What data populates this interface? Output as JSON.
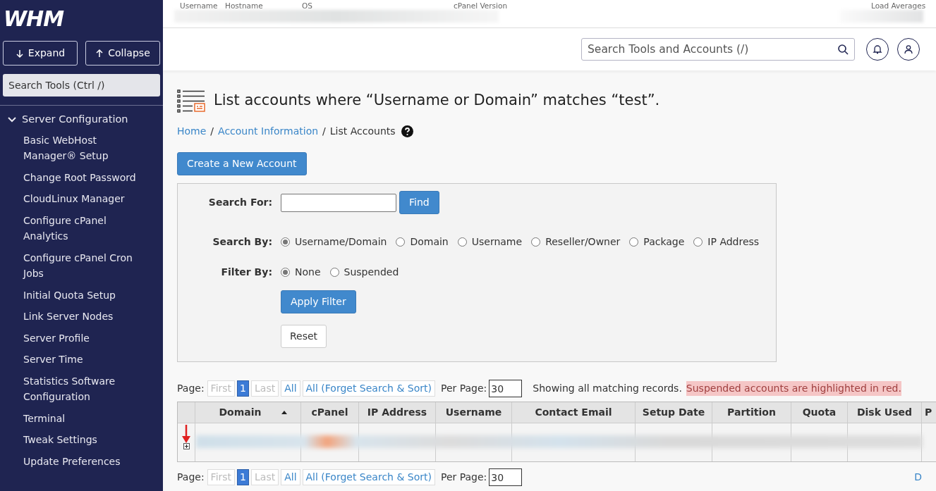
{
  "sidebar": {
    "logo": "WHM",
    "buttons": [
      {
        "kind": "expand",
        "label": "Expand"
      },
      {
        "kind": "collapse",
        "label": "Collapse"
      }
    ],
    "search": {
      "placeholder": "Search Tools (Ctrl /)"
    },
    "section": {
      "label": "Server Configuration",
      "expanded": true,
      "items": [
        "Basic WebHost Manager® Setup",
        "Change Root Password",
        "CloudLinux Manager",
        "Configure cPanel Analytics",
        "Configure cPanel Cron Jobs",
        "Initial Quota Setup",
        "Link Server Nodes",
        "Server Profile",
        "Server Time",
        "Statistics Software Configuration",
        "Terminal",
        "Tweak Settings",
        "Update Preferences"
      ]
    }
  },
  "server_info": {
    "labels": [
      "Username",
      "Hostname",
      "OS",
      "cPanel Version",
      "Load Averages"
    ]
  },
  "header": {
    "search": {
      "placeholder": "Search Tools and Accounts (/)"
    }
  },
  "page": {
    "title": "List accounts where “Username or Domain” matches “test”.",
    "breadcrumb": [
      {
        "label": "Home",
        "link": true,
        "separator": "/"
      },
      {
        "label": "Account Information",
        "link": true,
        "separator": "/"
      },
      {
        "label": "List Accounts",
        "link": false
      }
    ],
    "create_button": "Create a New Account",
    "form": {
      "search_label": "Search For:",
      "find_button": "Find",
      "search_by": {
        "label": "Search By:",
        "options": [
          {
            "label": "Username/Domain",
            "selected": true
          },
          {
            "label": "Domain",
            "selected": false
          },
          {
            "label": "Username",
            "selected": false
          },
          {
            "label": "Reseller/Owner",
            "selected": false
          },
          {
            "label": "Package",
            "selected": false
          },
          {
            "label": "IP Address",
            "selected": false
          }
        ]
      },
      "filter_by": {
        "label": "Filter By:",
        "options": [
          {
            "label": "None",
            "selected": true
          },
          {
            "label": "Suspended",
            "selected": false
          }
        ]
      },
      "apply_button": "Apply Filter",
      "reset_button": "Reset"
    },
    "pagination": [
      {
        "page_label": "Page:",
        "items": [
          {
            "label": "First",
            "disabled": true,
            "selected": false
          },
          {
            "label": "1",
            "disabled": false,
            "selected": true
          },
          {
            "label": "Last",
            "disabled": true,
            "selected": false
          },
          {
            "label": "All",
            "disabled": false,
            "selected": false
          },
          {
            "label": "All (Forget Search & Sort)",
            "disabled": false,
            "selected": false
          }
        ],
        "per_page_label": "Per Page:",
        "per_page": "30",
        "note": "Showing all matching records.",
        "highlight_note": "Suspended accounts are highlighted in red."
      },
      {
        "page_label": "Page:",
        "items": [
          {
            "label": "First",
            "disabled": true,
            "selected": false
          },
          {
            "label": "1",
            "disabled": false,
            "selected": true
          },
          {
            "label": "Last",
            "disabled": true,
            "selected": false
          },
          {
            "label": "All",
            "disabled": false,
            "selected": false
          },
          {
            "label": "All (Forget Search & Sort)",
            "disabled": false,
            "selected": false
          }
        ],
        "per_page_label": "Per Page:",
        "per_page": "30",
        "trailing": "D"
      }
    ],
    "table": {
      "columns": [
        {
          "label": "Domain",
          "sort_ascending": true
        },
        {
          "label": "cPanel"
        },
        {
          "label": "IP Address"
        },
        {
          "label": "Username"
        },
        {
          "label": "Contact Email"
        },
        {
          "label": "Setup Date"
        },
        {
          "label": "Partition"
        },
        {
          "label": "Quota"
        },
        {
          "label": "Disk Used"
        },
        {
          "label": "P"
        }
      ]
    }
  }
}
